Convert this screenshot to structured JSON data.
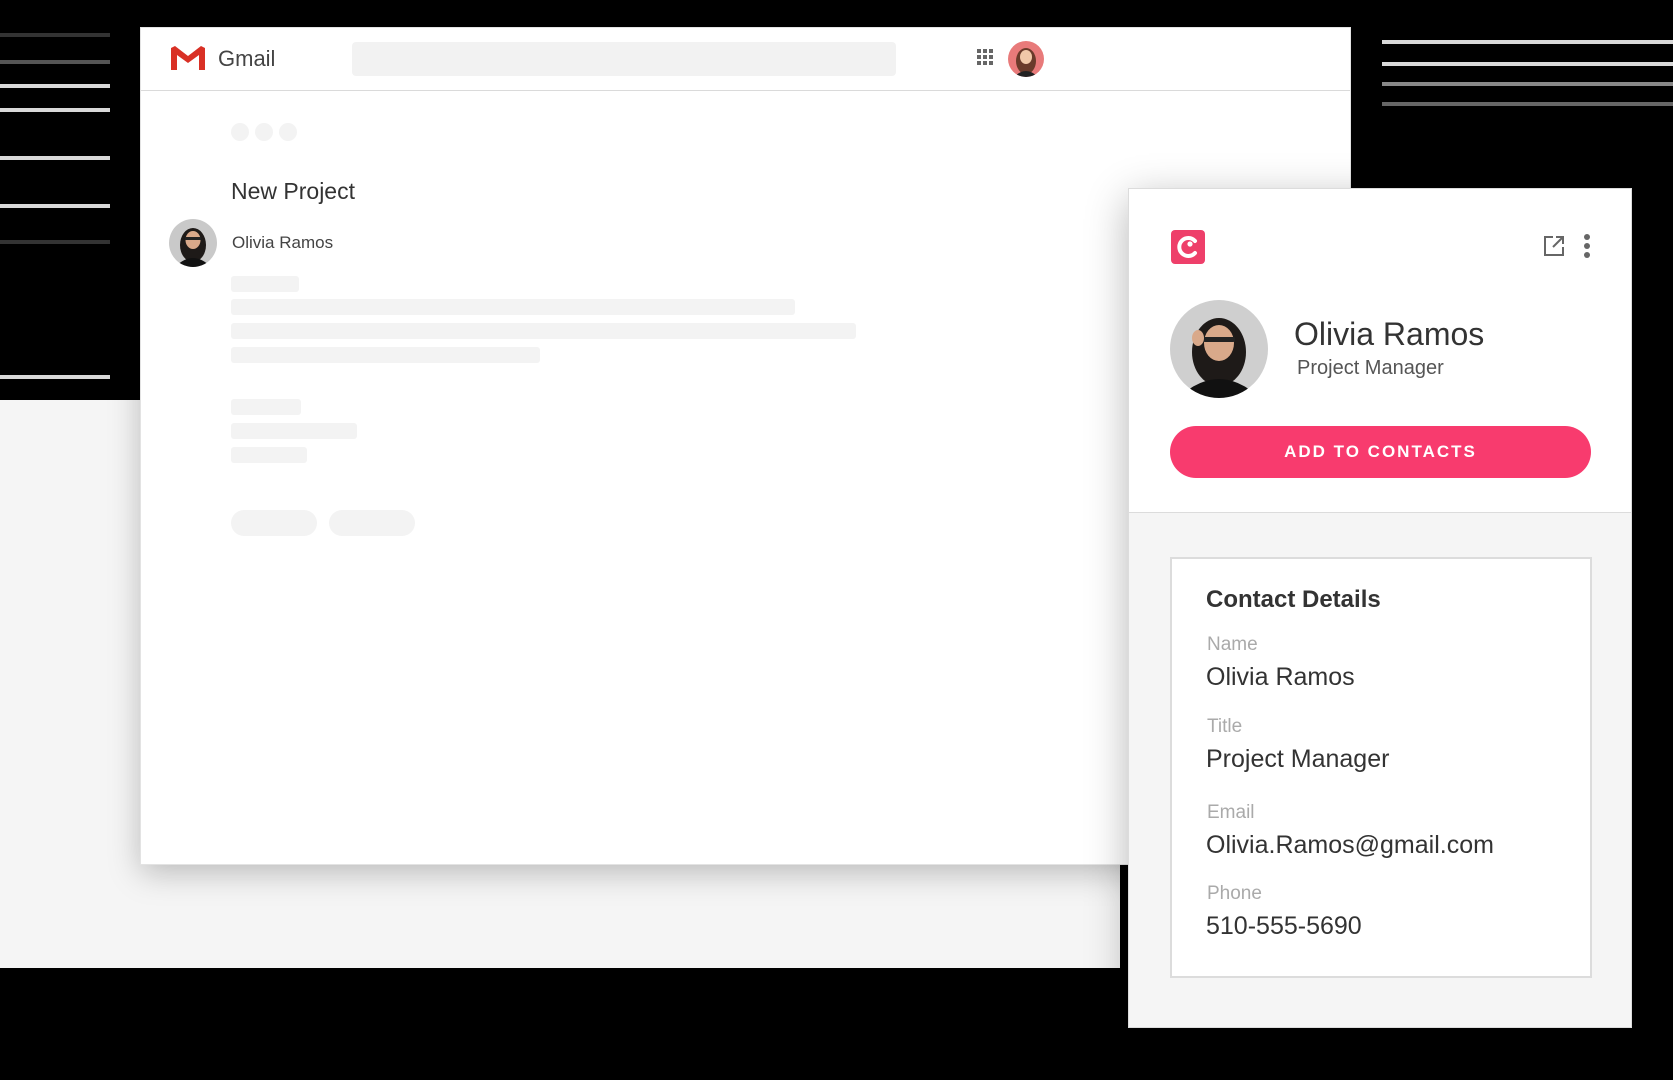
{
  "gmail": {
    "app_name": "Gmail",
    "email": {
      "subject": "New Project",
      "sender_name": "Olivia Ramos"
    }
  },
  "contact_card": {
    "name": "Olivia Ramos",
    "title": "Project Manager",
    "add_button_label": "ADD TO CONTACTS",
    "details": {
      "heading": "Contact Details",
      "fields": [
        {
          "label": "Name",
          "value": "Olivia Ramos"
        },
        {
          "label": "Title",
          "value": "Project Manager"
        },
        {
          "label": "Email",
          "value": "Olivia.Ramos@gmail.com"
        },
        {
          "label": "Phone",
          "value": "510-555-5690"
        }
      ]
    }
  },
  "icons": {
    "gmail_logo": "gmail-logo-icon",
    "apps": "apps-grid-icon",
    "brand": "crm-brand-icon",
    "open_external": "open-external-icon",
    "more": "more-vertical-icon"
  },
  "colors": {
    "accent": "#f83b6e",
    "brand": "#ee3f6a",
    "gmail_red": "#d93025"
  }
}
